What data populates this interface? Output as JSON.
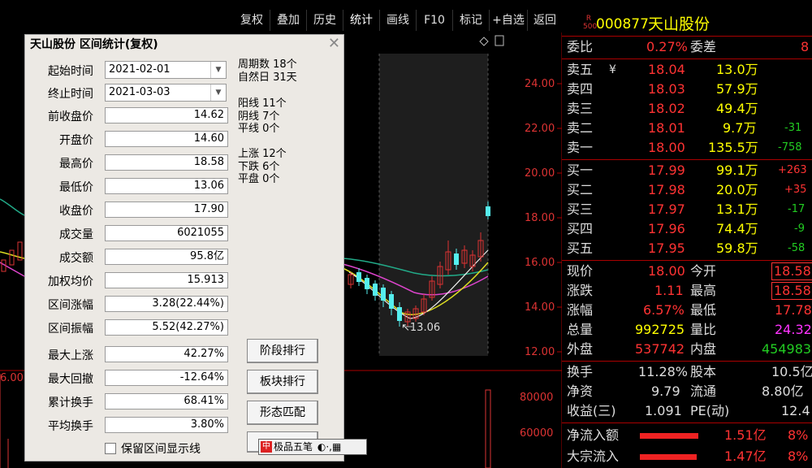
{
  "toolbar": {
    "items": [
      {
        "label": "复权"
      },
      {
        "label": "叠加"
      },
      {
        "label": "历史"
      },
      {
        "label": "统计"
      },
      {
        "label": "画线"
      },
      {
        "label": "F10"
      },
      {
        "label": "标记"
      },
      {
        "label": "+自选"
      },
      {
        "label": "返回"
      }
    ]
  },
  "chart": {
    "y_ticks": [
      "24.00",
      "22.00",
      "20.00",
      "18.00",
      "16.00",
      "14.00",
      "12.00"
    ],
    "vol_ticks": [
      "80000",
      "60000"
    ],
    "low_marker": "13.06",
    "left_price": "6.00"
  },
  "dialog": {
    "title": "天山股份 区间统计(复权)",
    "start_label": "起始时间",
    "start_value": "2021-02-01",
    "end_label": "终止时间",
    "end_value": "2021-03-03",
    "fields": [
      {
        "label": "前收盘价",
        "value": "14.62"
      },
      {
        "label": "开盘价",
        "value": "14.60"
      },
      {
        "label": "最高价",
        "value": "18.58"
      },
      {
        "label": "最低价",
        "value": "13.06"
      },
      {
        "label": "收盘价",
        "value": "17.90"
      },
      {
        "label": "成交量",
        "value": "6021055"
      },
      {
        "label": "成交额",
        "value": "95.8亿"
      },
      {
        "label": "加权均价",
        "value": "15.913"
      },
      {
        "label": "区间涨幅",
        "value": "3.28(22.44%)"
      },
      {
        "label": "区间振幅",
        "value": "5.52(42.27%)"
      },
      {
        "label": "最大上涨",
        "value": "42.27%"
      },
      {
        "label": "最大回撤",
        "value": "-12.64%"
      },
      {
        "label": "累计换手",
        "value": "68.41%"
      },
      {
        "label": "平均换手",
        "value": "3.80%"
      }
    ],
    "stats": {
      "period_count": "周期数 18个",
      "natural_days": "自然日 31天",
      "yang": "阳线 11个",
      "yin": "阴线 7个",
      "flat_line": "平线 0个",
      "up": "上涨 12个",
      "down": "下跌 6个",
      "flat": "平盘 0个"
    },
    "buttons": [
      "阶段排行",
      "板块排行",
      "形态匹配"
    ],
    "keep_label": "保留区间显示线"
  },
  "ime": {
    "label": "极品五笔"
  },
  "quote": {
    "code": "000877",
    "name": "天山股份",
    "badge_top": "R",
    "badge_bottom": "500",
    "weibi_label": "委比",
    "weibi": "0.27%",
    "weicha_label": "委差",
    "weicha": "8",
    "sell": [
      {
        "label": "卖五",
        "price": "18.04",
        "vol": "13.0万",
        "chg": ""
      },
      {
        "label": "卖四",
        "price": "18.03",
        "vol": "57.9万",
        "chg": ""
      },
      {
        "label": "卖三",
        "price": "18.02",
        "vol": "49.4万",
        "chg": ""
      },
      {
        "label": "卖二",
        "price": "18.01",
        "vol": "9.7万",
        "chg": "-31"
      },
      {
        "label": "卖一",
        "price": "18.00",
        "vol": "135.5万",
        "chg": "-758"
      }
    ],
    "buy": [
      {
        "label": "买一",
        "price": "17.99",
        "vol": "99.1万",
        "chg": "+263"
      },
      {
        "label": "买二",
        "price": "17.98",
        "vol": "20.0万",
        "chg": "+35"
      },
      {
        "label": "买三",
        "price": "17.97",
        "vol": "13.1万",
        "chg": "-17"
      },
      {
        "label": "买四",
        "price": "17.96",
        "vol": "74.4万",
        "chg": "-9"
      },
      {
        "label": "买五",
        "price": "17.95",
        "vol": "59.8万",
        "chg": "-58"
      }
    ],
    "stats": [
      {
        "l1": "现价",
        "v1": "18.00",
        "l2": "今开",
        "v2": "18.58"
      },
      {
        "l1": "涨跌",
        "v1": "1.11",
        "l2": "最高",
        "v2": "18.58"
      },
      {
        "l1": "涨幅",
        "v1": "6.57%",
        "l2": "最低",
        "v2": "17.78"
      },
      {
        "l1": "总量",
        "v1": "992725",
        "l2": "量比",
        "v2": "24.32"
      },
      {
        "l1": "外盘",
        "v1": "537742",
        "l2": "内盘",
        "v2": "454983"
      }
    ],
    "stats2": [
      {
        "l1": "换手",
        "v1": "11.28%",
        "l2": "股本",
        "v2": "10.5亿"
      },
      {
        "l1": "净资",
        "v1": "9.79",
        "l2": "流通",
        "v2": "8.80亿"
      },
      {
        "l1": "收益(三)",
        "v1": "1.091",
        "l2": "PE(动)",
        "v2": "12.4"
      }
    ],
    "flow": [
      {
        "label": "净流入额",
        "value": "1.51亿",
        "pct": "8%"
      },
      {
        "label": "大宗流入",
        "value": "1.47亿",
        "pct": "8%"
      }
    ]
  }
}
